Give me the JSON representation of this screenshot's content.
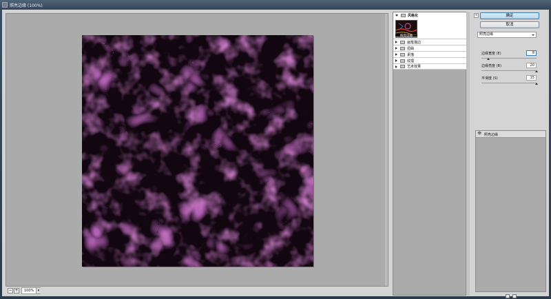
{
  "window": {
    "title": "照亮边缘 (100%)"
  },
  "preview": {
    "zoom_minus": "−",
    "zoom_plus": "+",
    "zoom_value": "100%"
  },
  "gallery": {
    "open_category": "风格化",
    "open_filter_thumb": "照亮边缘",
    "categories": [
      "画笔描边",
      "扭曲",
      "素描",
      "纹理",
      "艺术效果"
    ]
  },
  "side": {
    "ok_label": "确定",
    "cancel_label": "取消",
    "collapse_icon": "«",
    "selected_filter": "照亮边缘",
    "params": [
      {
        "label": "边缘宽度 (E)",
        "value": "8",
        "level": 0.13
      },
      {
        "label": "边缘亮度 (B)",
        "value": "20",
        "level": 1.0
      },
      {
        "label": "平滑度 (S)",
        "value": "15",
        "level": 1.0
      }
    ],
    "layer_name": "照亮边缘",
    "eye_icon": "eye-icon"
  },
  "colors": {
    "accent": "#3d7bad",
    "texture_dark": "#120610",
    "texture_light": "#9a3b94"
  }
}
